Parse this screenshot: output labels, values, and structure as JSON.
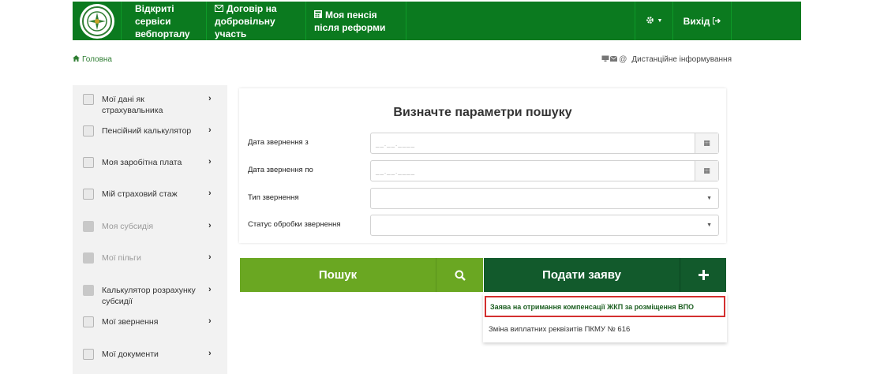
{
  "nav": {
    "logo_icon": "pension-fund-emblem",
    "item1": "Відкриті сервіси вебпорталу",
    "item1_line1": "Відкриті сервіси",
    "item1_line2": "вебпорталу",
    "item2_line1": "Договір на",
    "item2_line2": "добровільну участь",
    "item2_icon": "envelope-icon",
    "item3_line1": "Моя пенсія",
    "item3_line2": "після реформи",
    "item3_icon": "calculator-icon",
    "settings_icon": "gear-icon",
    "exit_label": "Вихід",
    "exit_icon": "sign-out-icon",
    "brand_color": "#0b7a1f"
  },
  "breadcrumb": {
    "home_label": "Головна",
    "home_icon": "home-icon"
  },
  "remote": {
    "label": "Дистанційне інформування",
    "icons": [
      "monitor-icon",
      "envelope-icon",
      "at-icon"
    ]
  },
  "sidebar": {
    "items": [
      {
        "label": "Мої дані як страхувальника",
        "dim": false,
        "icon": "document-icon"
      },
      {
        "label": "Пенсійний калькулятор",
        "dim": false,
        "icon": "calculator-icon"
      },
      {
        "label": "Моя заробітна плата",
        "dim": false,
        "icon": "wallet-icon"
      },
      {
        "label": "Мій страховий стаж",
        "dim": false,
        "icon": "calendar-icon"
      },
      {
        "label": "Моя субсидія",
        "dim": true,
        "icon": "folder-icon"
      },
      {
        "label": "Мої пільги",
        "dim": true,
        "icon": "folder-icon"
      },
      {
        "label": "Калькулятор розрахунку субсидії",
        "dim": false,
        "icon": "folder-icon"
      },
      {
        "label": "Мої звернення",
        "dim": false,
        "icon": "envelope-icon"
      },
      {
        "label": "Мої документи",
        "dim": false,
        "icon": "document-icon"
      }
    ]
  },
  "search_panel": {
    "title": "Визначте параметри пошуку",
    "fields": [
      {
        "label": "Дата звернення з",
        "placeholder": "__.__.____",
        "type": "date"
      },
      {
        "label": "Дата звернення по",
        "placeholder": "__.__.____",
        "type": "date"
      },
      {
        "label": "Тип звернення",
        "placeholder": "",
        "type": "select"
      },
      {
        "label": "Статус обробки звернення",
        "placeholder": "",
        "type": "select"
      }
    ]
  },
  "buttons": {
    "search_label": "Пошук",
    "search_icon": "search-icon",
    "search_color": "#6aa722",
    "submit_label": "Подати заяву",
    "submit_icon": "plus-icon",
    "submit_color": "#125a2c"
  },
  "dropdown": {
    "items": [
      "Заява на отримання компенсації ЖКП за розміщення ВПО",
      "Зміна виплатних реквізитів ПКМУ № 616"
    ],
    "highlight_color": "#d32f2f"
  }
}
